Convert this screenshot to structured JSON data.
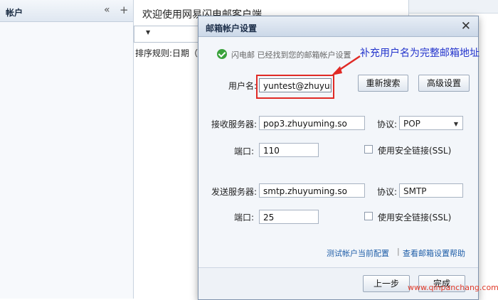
{
  "sidebar": {
    "title": "帐户",
    "collapse_glyph": "«",
    "add_glyph": "+"
  },
  "main": {
    "welcome": "欢迎使用网易闪电邮客户端",
    "sort_rule": "排序规则:日期（升"
  },
  "dialog": {
    "title": "邮箱帐户设置",
    "close_glyph": "✕",
    "status_text": "闪电邮 已经找到您的邮箱帐户设置",
    "username_label": "用户名:",
    "username_value": "yuntest@zhuyum",
    "btn_research": "重新搜索",
    "btn_advanced": "高级设置",
    "incoming_label": "接收服务器:",
    "incoming_value": "pop3.zhuyuming.so",
    "incoming_protocol_label": "协议:",
    "incoming_protocol_value": "POP",
    "incoming_port_label": "端口:",
    "incoming_port_value": "110",
    "incoming_ssl_label": "使用安全链接(SSL)",
    "outgoing_label": "发送服务器:",
    "outgoing_value": "smtp.zhuyuming.so",
    "outgoing_protocol_label": "协议:",
    "outgoing_protocol_value": "SMTP",
    "outgoing_port_label": "端口:",
    "outgoing_port_value": "25",
    "outgoing_ssl_label": "使用安全链接(SSL)",
    "link_test": "测试帐户当前配置",
    "link_sep": "|",
    "link_help": "查看邮箱设置帮助",
    "btn_prev": "上一步",
    "btn_finish": "完成"
  },
  "annotation": {
    "text": "补充用户名为完整邮箱地址",
    "color": "#2233cc",
    "arrow_color": "#e02a25"
  },
  "watermark": "www.qinpanchang.com"
}
